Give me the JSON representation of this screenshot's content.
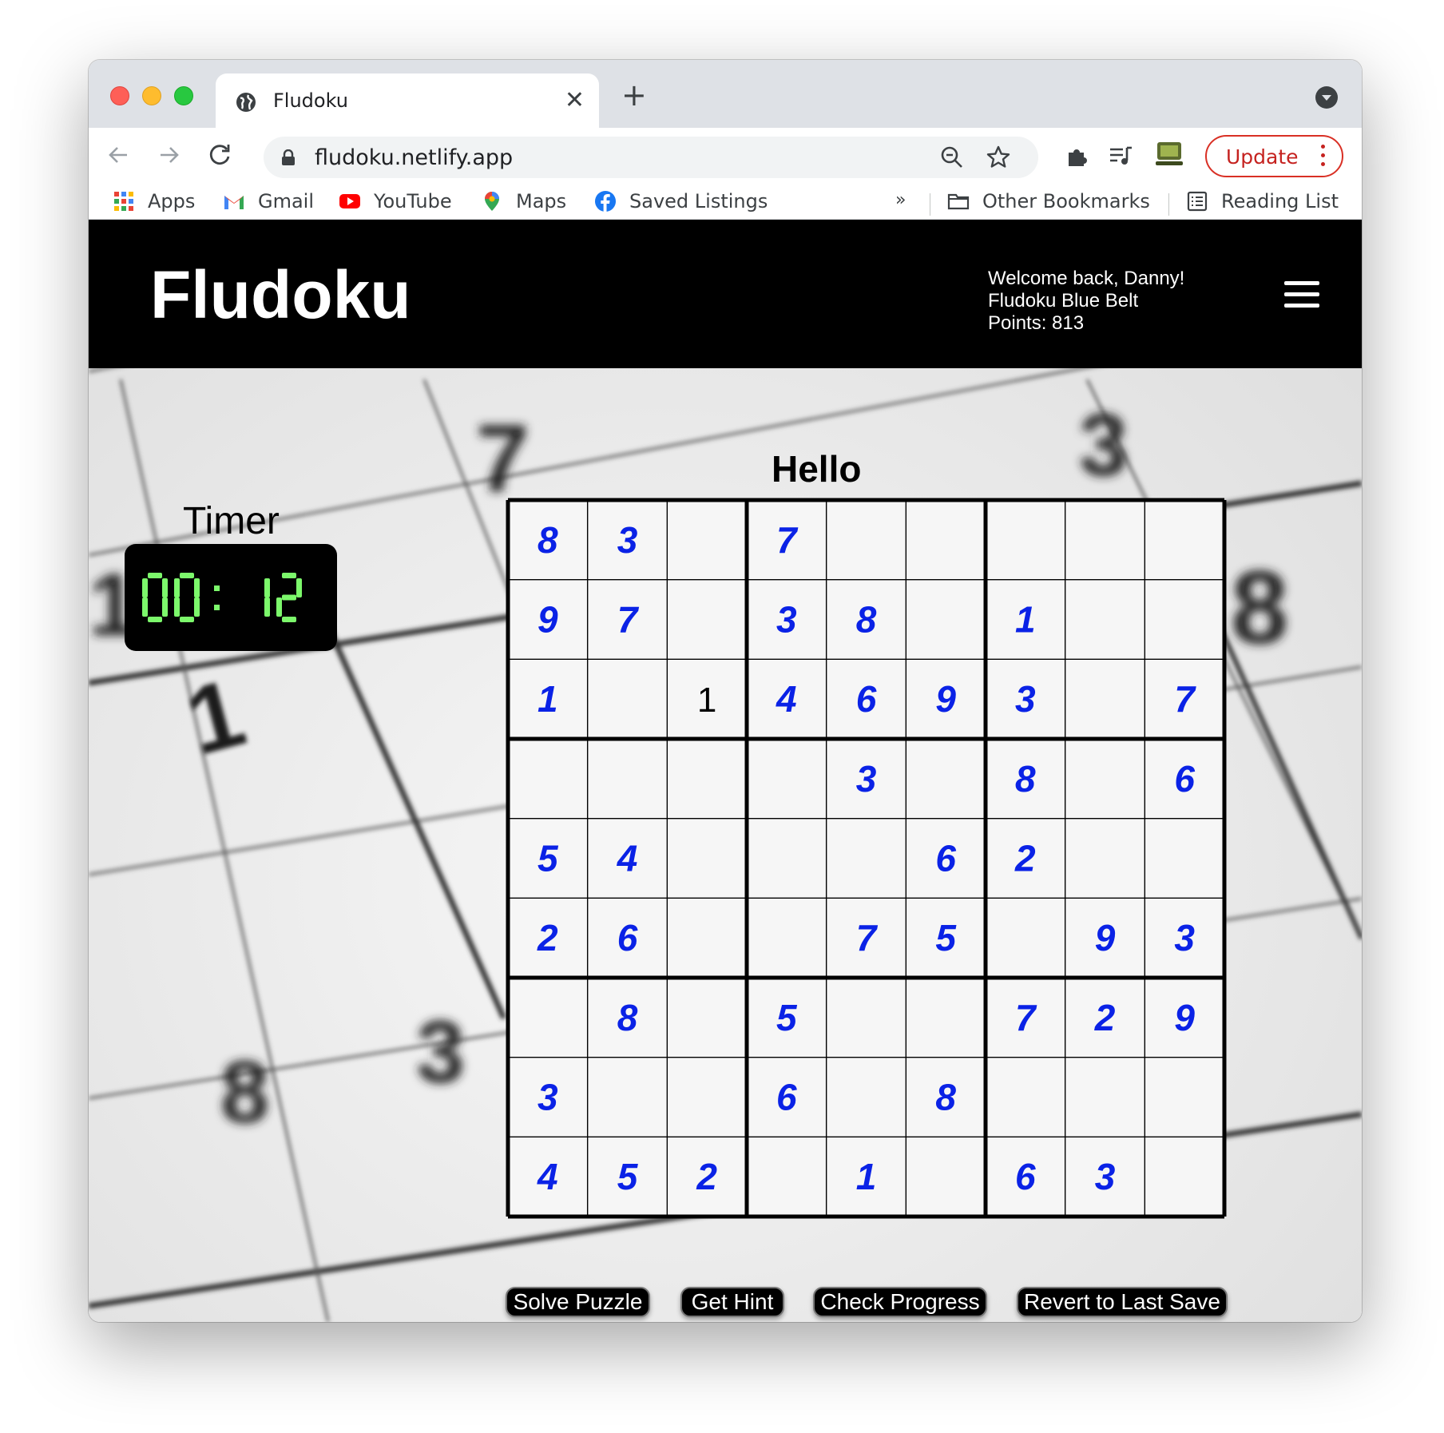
{
  "browser": {
    "tab_title": "Fludoku",
    "tab_close": "✕",
    "new_tab": "+",
    "url": "fludoku.netlify.app",
    "update_label": "Update",
    "bookmarks": [
      {
        "label": "Apps",
        "icon": "apps-grid-icon"
      },
      {
        "label": "Gmail",
        "icon": "gmail-icon"
      },
      {
        "label": "YouTube",
        "icon": "youtube-icon"
      },
      {
        "label": "Maps",
        "icon": "maps-pin-icon"
      },
      {
        "label": "Saved Listings",
        "icon": "facebook-icon"
      }
    ],
    "bookmarks_overflow": "»",
    "other_bookmarks": "Other Bookmarks",
    "reading_list": "Reading List"
  },
  "site": {
    "title": "Fludoku",
    "welcome": "Welcome back, Danny!",
    "belt": "Fludoku Blue Belt",
    "points": "Points: 813"
  },
  "timer": {
    "label": "Timer",
    "minutes": "00",
    "seconds": "12",
    "digit_color": "#7cf86b"
  },
  "board": {
    "heading": "Hello",
    "given_color": "#0a22e6",
    "entry_color": "#000000",
    "cells": [
      [
        {
          "v": "8",
          "t": "given"
        },
        {
          "v": "3",
          "t": "given"
        },
        {
          "v": "",
          "t": ""
        },
        {
          "v": "7",
          "t": "given"
        },
        {
          "v": "",
          "t": ""
        },
        {
          "v": "",
          "t": ""
        },
        {
          "v": "",
          "t": ""
        },
        {
          "v": "",
          "t": ""
        },
        {
          "v": "",
          "t": ""
        }
      ],
      [
        {
          "v": "9",
          "t": "given"
        },
        {
          "v": "7",
          "t": "given"
        },
        {
          "v": "",
          "t": ""
        },
        {
          "v": "3",
          "t": "given"
        },
        {
          "v": "8",
          "t": "given"
        },
        {
          "v": "",
          "t": ""
        },
        {
          "v": "1",
          "t": "given"
        },
        {
          "v": "",
          "t": ""
        },
        {
          "v": "",
          "t": ""
        }
      ],
      [
        {
          "v": "1",
          "t": "given"
        },
        {
          "v": "",
          "t": ""
        },
        {
          "v": "1",
          "t": "entry"
        },
        {
          "v": "4",
          "t": "given"
        },
        {
          "v": "6",
          "t": "given"
        },
        {
          "v": "9",
          "t": "given"
        },
        {
          "v": "3",
          "t": "given"
        },
        {
          "v": "",
          "t": ""
        },
        {
          "v": "7",
          "t": "given"
        }
      ],
      [
        {
          "v": "",
          "t": ""
        },
        {
          "v": "",
          "t": ""
        },
        {
          "v": "",
          "t": ""
        },
        {
          "v": "",
          "t": ""
        },
        {
          "v": "3",
          "t": "given"
        },
        {
          "v": "",
          "t": ""
        },
        {
          "v": "8",
          "t": "given"
        },
        {
          "v": "",
          "t": ""
        },
        {
          "v": "6",
          "t": "given"
        }
      ],
      [
        {
          "v": "5",
          "t": "given"
        },
        {
          "v": "4",
          "t": "given"
        },
        {
          "v": "",
          "t": ""
        },
        {
          "v": "",
          "t": ""
        },
        {
          "v": "",
          "t": ""
        },
        {
          "v": "6",
          "t": "given"
        },
        {
          "v": "2",
          "t": "given"
        },
        {
          "v": "",
          "t": ""
        },
        {
          "v": "",
          "t": ""
        }
      ],
      [
        {
          "v": "2",
          "t": "given"
        },
        {
          "v": "6",
          "t": "given"
        },
        {
          "v": "",
          "t": ""
        },
        {
          "v": "",
          "t": ""
        },
        {
          "v": "7",
          "t": "given"
        },
        {
          "v": "5",
          "t": "given"
        },
        {
          "v": "",
          "t": ""
        },
        {
          "v": "9",
          "t": "given"
        },
        {
          "v": "3",
          "t": "given"
        }
      ],
      [
        {
          "v": "",
          "t": ""
        },
        {
          "v": "8",
          "t": "given"
        },
        {
          "v": "",
          "t": ""
        },
        {
          "v": "5",
          "t": "given"
        },
        {
          "v": "",
          "t": ""
        },
        {
          "v": "",
          "t": ""
        },
        {
          "v": "7",
          "t": "given"
        },
        {
          "v": "2",
          "t": "given"
        },
        {
          "v": "9",
          "t": "given"
        }
      ],
      [
        {
          "v": "3",
          "t": "given"
        },
        {
          "v": "",
          "t": ""
        },
        {
          "v": "",
          "t": ""
        },
        {
          "v": "6",
          "t": "given"
        },
        {
          "v": "",
          "t": ""
        },
        {
          "v": "8",
          "t": "given"
        },
        {
          "v": "",
          "t": ""
        },
        {
          "v": "",
          "t": ""
        },
        {
          "v": "",
          "t": ""
        }
      ],
      [
        {
          "v": "4",
          "t": "given"
        },
        {
          "v": "5",
          "t": "given"
        },
        {
          "v": "2",
          "t": "given"
        },
        {
          "v": "",
          "t": ""
        },
        {
          "v": "1",
          "t": "given"
        },
        {
          "v": "",
          "t": ""
        },
        {
          "v": "6",
          "t": "given"
        },
        {
          "v": "3",
          "t": "given"
        },
        {
          "v": ""
        }
      ]
    ]
  },
  "actions": {
    "solve": "Solve Puzzle",
    "hint": "Get Hint",
    "check": "Check Progress",
    "revert": "Revert to Last Save"
  }
}
